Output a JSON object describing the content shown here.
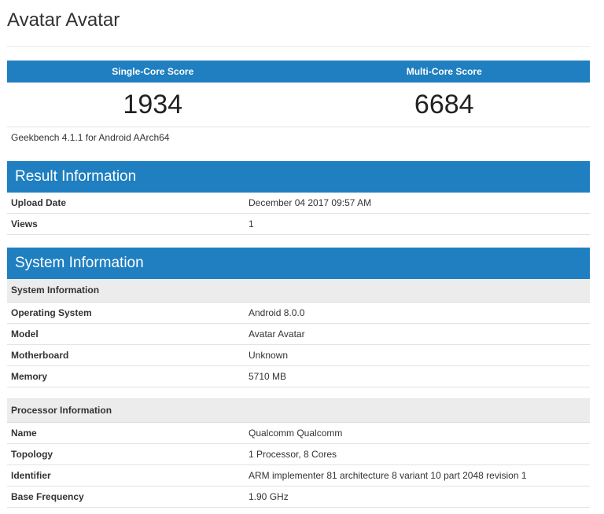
{
  "page": {
    "title": "Avatar Avatar"
  },
  "scores": {
    "single_label": "Single-Core Score",
    "multi_label": "Multi-Core Score",
    "single_value": "1934",
    "multi_value": "6684",
    "version": "Geekbench 4.1.1 for Android AArch64"
  },
  "result_info": {
    "header": "Result Information",
    "rows": [
      {
        "label": "Upload Date",
        "value": "December 04 2017 09:57 AM"
      },
      {
        "label": "Views",
        "value": "1"
      }
    ]
  },
  "system_info": {
    "header": "System Information",
    "system_subheader": "System Information",
    "system_rows": [
      {
        "label": "Operating System",
        "value": "Android 8.0.0"
      },
      {
        "label": "Model",
        "value": "Avatar Avatar"
      },
      {
        "label": "Motherboard",
        "value": "Unknown"
      },
      {
        "label": "Memory",
        "value": "5710 MB"
      }
    ],
    "processor_subheader": "Processor Information",
    "processor_rows": [
      {
        "label": "Name",
        "value": "Qualcomm Qualcomm"
      },
      {
        "label": "Topology",
        "value": "1 Processor, 8 Cores"
      },
      {
        "label": "Identifier",
        "value": "ARM implementer 81 architecture 8 variant 10 part 2048 revision 1"
      },
      {
        "label": "Base Frequency",
        "value": "1.90 GHz"
      }
    ]
  },
  "colors": {
    "header_blue": "#1f7fc0",
    "subhead_gray": "#ececec"
  }
}
